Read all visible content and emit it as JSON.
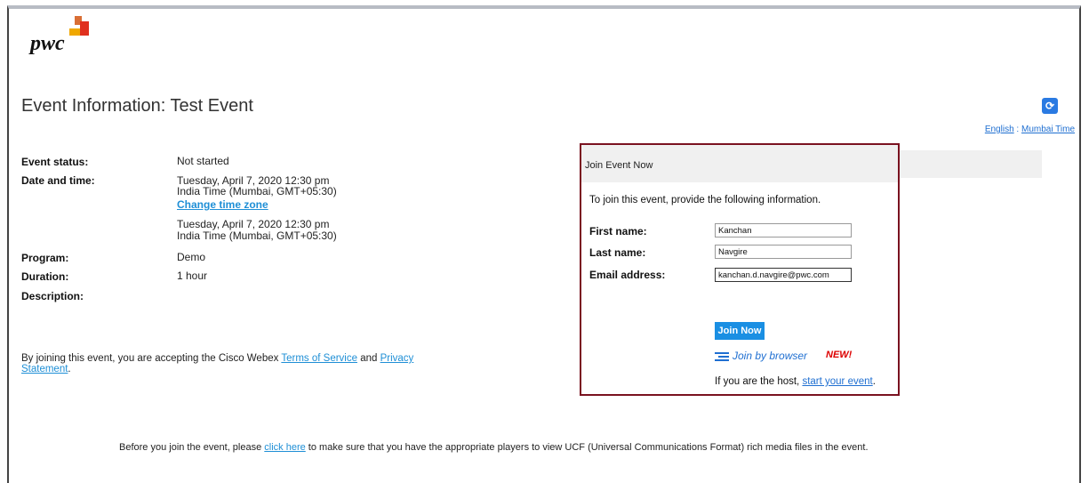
{
  "logo": {
    "text": "pwc"
  },
  "page": {
    "title": "Event Information: Test Event"
  },
  "locale": {
    "language": "English",
    "separator": ":",
    "timezone": "Mumbai Time"
  },
  "event": {
    "status_label": "Event status:",
    "status_value": "Not started",
    "date_label": "Date and time:",
    "date_line1": "Tuesday, April 7, 2020 12:30 pm",
    "date_line2": "India Time (Mumbai, GMT+05:30)",
    "change_tz_link": "Change time zone",
    "date2_line1": "Tuesday, April 7, 2020 12:30 pm",
    "date2_line2": "India Time (Mumbai, GMT+05:30)",
    "program_label": "Program:",
    "program_value": "Demo",
    "duration_label": "Duration:",
    "duration_value": "1 hour",
    "description_label": "Description:"
  },
  "terms": {
    "prefix": "By joining this event, you are accepting the Cisco Webex ",
    "tos_link": "Terms of Service",
    "and": " and ",
    "privacy_link_1": "Privacy",
    "privacy_link_2": "Statement",
    "suffix": "."
  },
  "join": {
    "header": "Join Event Now",
    "intro": "To join this event, provide the following information.",
    "first_name_label": "First name:",
    "first_name_value": "Kanchan",
    "last_name_label": "Last name:",
    "last_name_value": "Navgire",
    "email_label": "Email address:",
    "email_value": "kanchan.d.navgire@pwc.com",
    "join_button": "Join Now",
    "browser_link": "Join by browser",
    "new_badge": "NEW!",
    "host_prefix": "If you are the host, ",
    "host_link": "start your event",
    "host_suffix": "."
  },
  "bottom_note": {
    "prefix": "Before you join the event, please ",
    "link": "click here",
    "suffix": " to make sure that you have the appropriate players to view UCF (Universal Communications Format) rich media files in the event."
  },
  "icons": {
    "refresh": "refresh-icon",
    "browser": "browser-list-icon"
  },
  "colors": {
    "accent": "#1a8fe3",
    "panel_border": "#7a1220",
    "link": "#1f8fd6"
  }
}
